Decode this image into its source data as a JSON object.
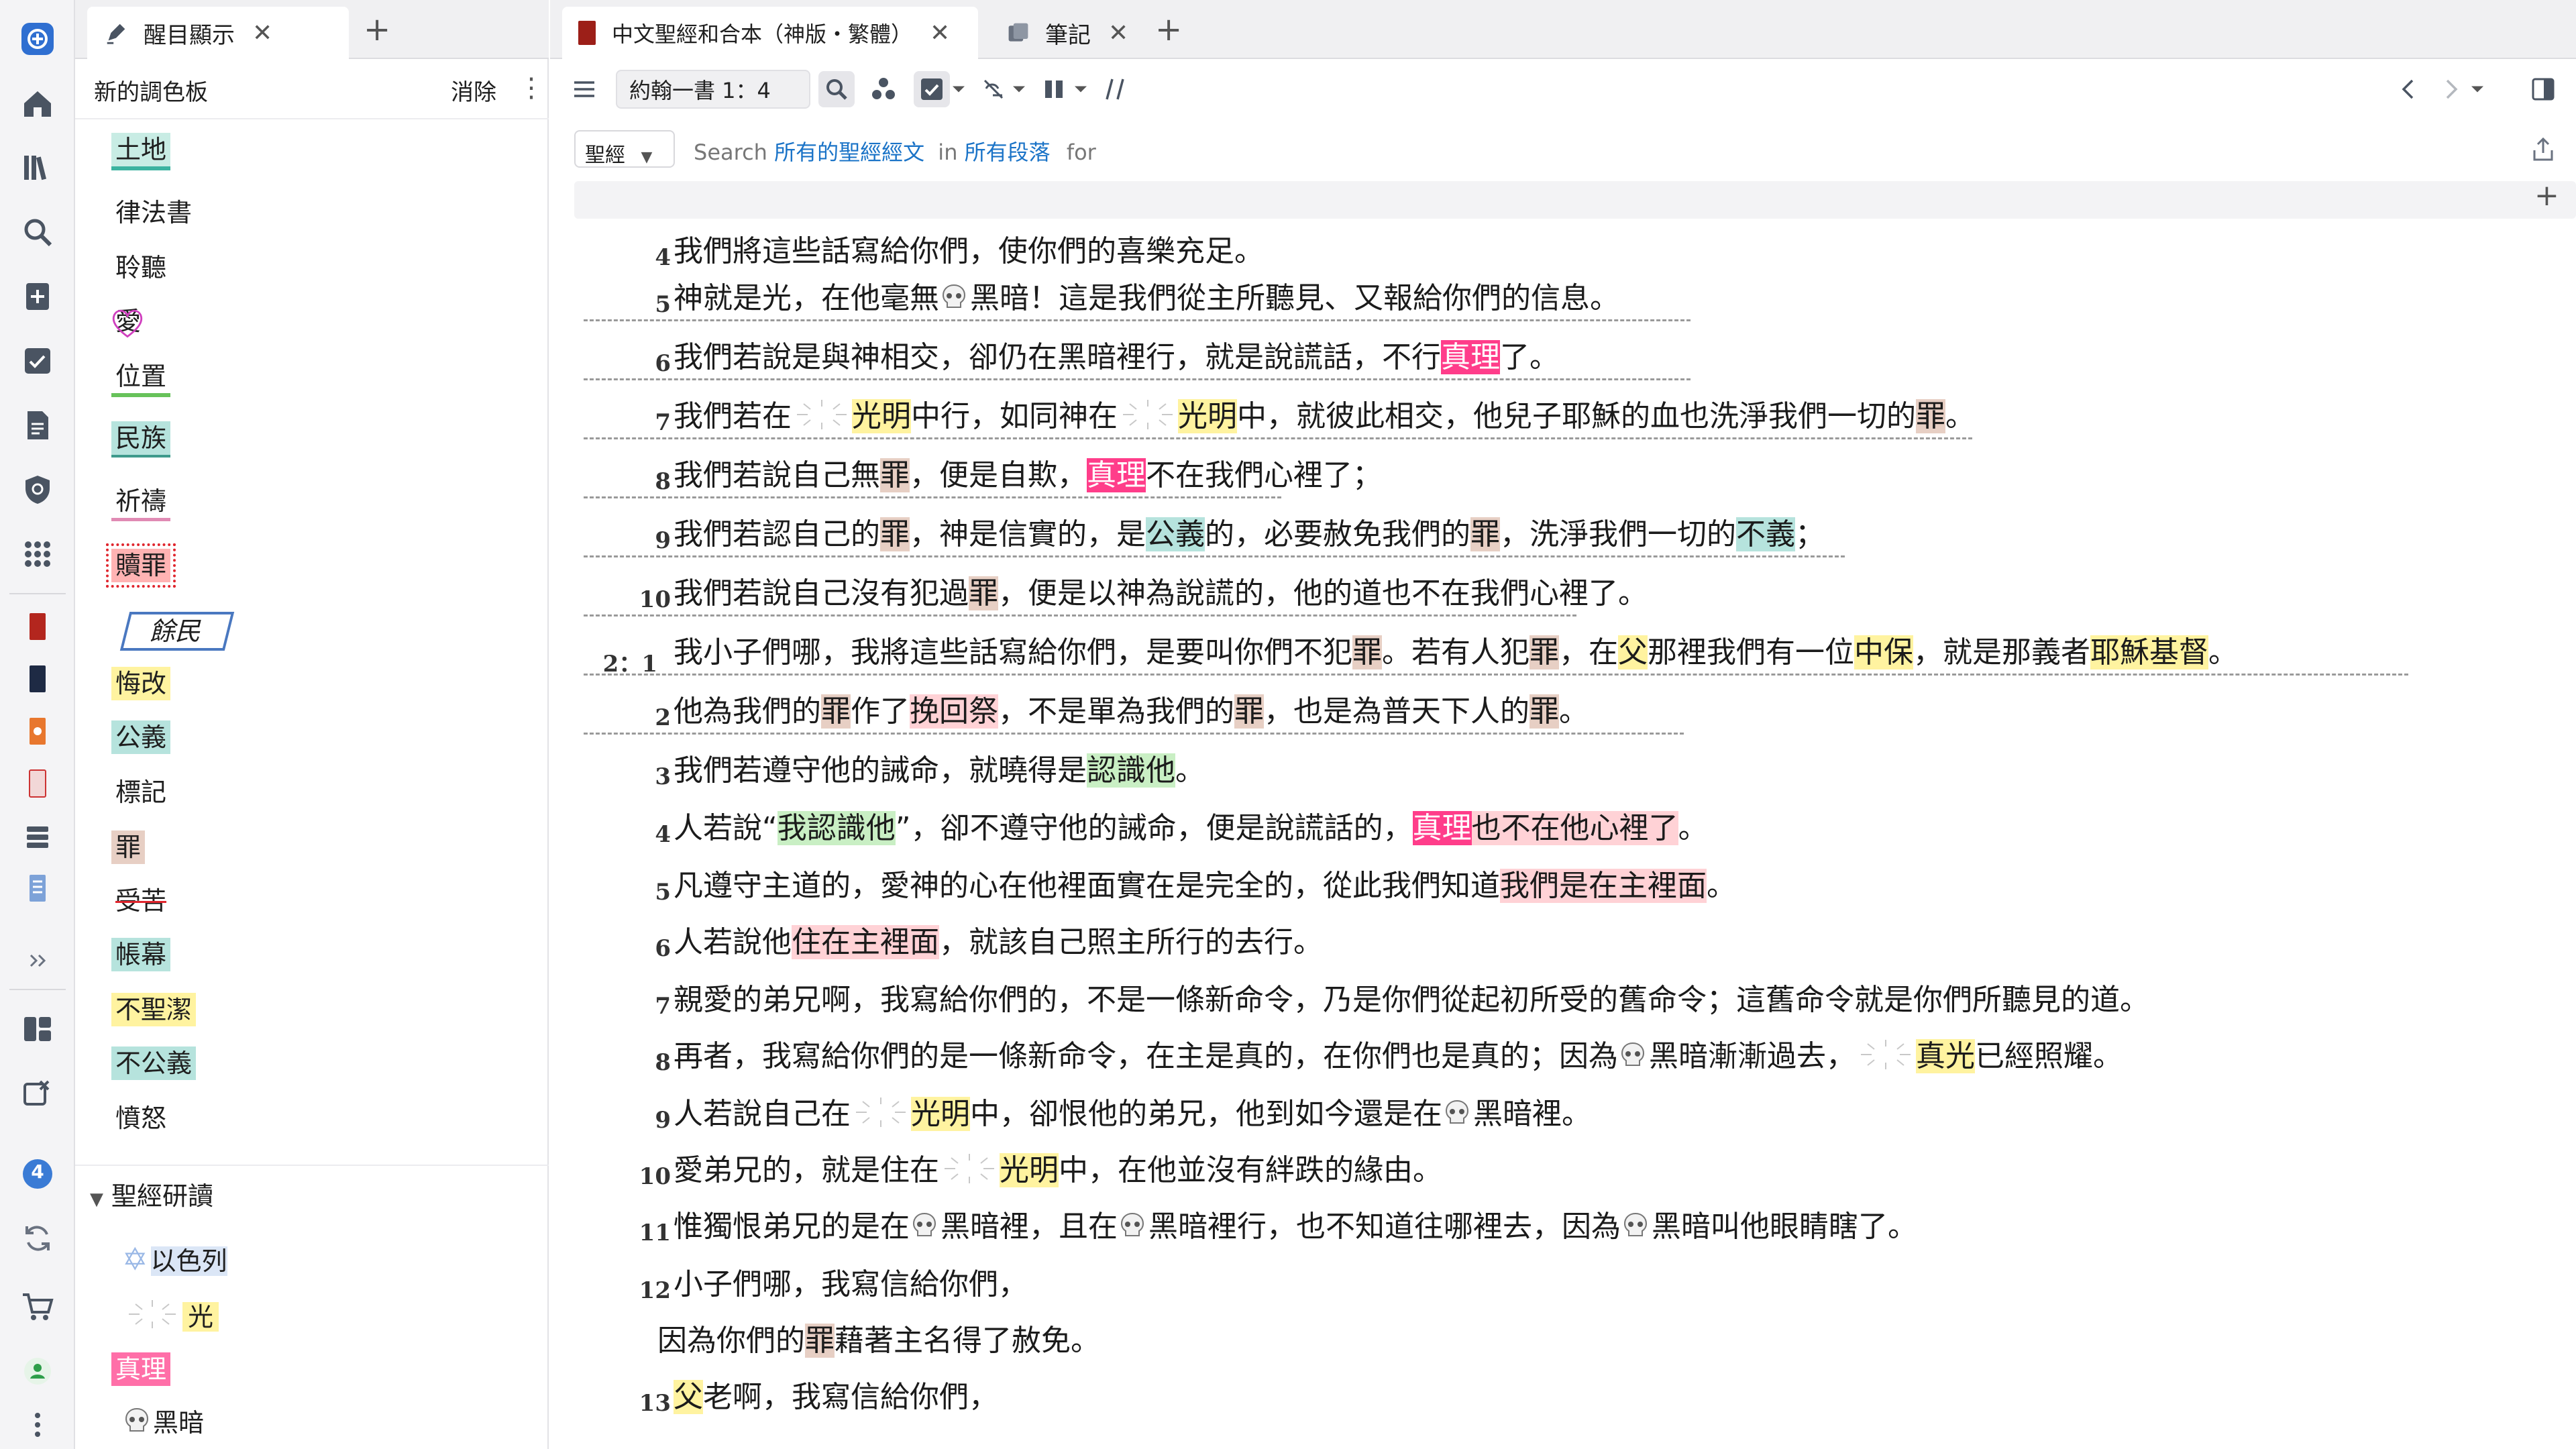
{
  "rail": {
    "icons": [
      "app-logo-icon",
      "home-icon",
      "library-icon",
      "search-icon",
      "add-note-icon",
      "checklist-icon",
      "document-icon",
      "shield-icon",
      "apps-grid-icon",
      "book-red-icon",
      "book-dark-icon",
      "book-orange-icon",
      "book-white-icon",
      "stack-icon",
      "book-blue-icon",
      "expand-icon",
      "layout-icon",
      "export-icon",
      "notification-badge",
      "sync-icon",
      "cart-icon",
      "user-icon",
      "more-icon"
    ],
    "badge": "4"
  },
  "left": {
    "tab_label": "醒目顯示",
    "palette_title": "新的調色板",
    "clear_label": "消除",
    "palette_items": [
      {
        "label": "土地",
        "style": "teal-underline"
      },
      {
        "label": "律法書",
        "style": "plain"
      },
      {
        "label": "聆聽",
        "style": "plain"
      },
      {
        "label": "愛",
        "style": "heart"
      },
      {
        "label": "位置",
        "style": "green-underline"
      },
      {
        "label": "民族",
        "style": "teal-box"
      },
      {
        "label": "祈禱",
        "style": "pink-underline"
      },
      {
        "label": "贖罪",
        "style": "red-burst"
      },
      {
        "label": "餘民",
        "style": "box-outline"
      },
      {
        "label": "悔改",
        "style": "yellow"
      },
      {
        "label": "公義",
        "style": "teal"
      },
      {
        "label": "標記",
        "style": "plain"
      },
      {
        "label": "罪",
        "style": "brown"
      },
      {
        "label": "受苦",
        "style": "strike"
      },
      {
        "label": "帳幕",
        "style": "teal"
      },
      {
        "label": "不聖潔",
        "style": "yellow"
      },
      {
        "label": "不公義",
        "style": "teal"
      },
      {
        "label": "憤怒",
        "style": "plain"
      }
    ],
    "study_title": "聖經研讀",
    "study_items": [
      {
        "label": "以色列",
        "style": "star"
      },
      {
        "label": "光",
        "style": "light"
      },
      {
        "label": "真理",
        "style": "pink"
      },
      {
        "label": "黑暗",
        "style": "skull"
      }
    ]
  },
  "main": {
    "tab_bible": "中文聖經和合本（神版・繁體）",
    "tab_notes": "筆記",
    "reference": "約翰一書 1：4",
    "scope": "聖經",
    "search": {
      "prefix": "Search",
      "all": "所有的聖經經文",
      "in": "in",
      "section": "所有段落",
      "for": "for"
    },
    "verses": [
      {
        "num": "4",
        "text": "我們將這些話寫給你們，使你們的喜樂充足。"
      },
      {
        "num": "5",
        "text": "神就是光，在他毫無[黑暗]！這是我們從主所聽見、又報給你們的信息。"
      },
      {
        "num": "6",
        "text": "我們若說是與神相交，卻仍在黑暗裡行，就是說謊話，不行真理了。"
      },
      {
        "num": "7",
        "text": "我們若在[光明]中行，如同神在[光明]中，就彼此相交，他兒子耶穌的血也洗淨我們一切的罪。"
      },
      {
        "num": "8",
        "text": "我們若說自己無罪，便是自欺，真理不在我們心裡了；"
      },
      {
        "num": "9",
        "text": "我們若認自己的罪，神是信實的，是公義的，必要赦免我們的罪，洗淨我們一切的不義；"
      },
      {
        "num": "10",
        "text": "我們若說自己沒有犯過罪，便是以神為說謊的，他的道也不在我們心裡了。"
      },
      {
        "num": "2：1",
        "text": "我小子們哪，我將這些話寫給你們，是要叫你們不犯罪。若有人犯罪，在父那裡我們有一位中保，就是那義者耶穌基督。"
      },
      {
        "num": "2",
        "text": "他為我們的罪作了挽回祭，不是單為我們的罪，也是為普天下人的罪。"
      },
      {
        "num": "3",
        "text": "我們若遵守他的誡命，就曉得是認識他。"
      },
      {
        "num": "4",
        "text": "人若說“我認識他”，卻不遵守他的誡命，便是說謊話的，真理也不在他心裡了。"
      },
      {
        "num": "5",
        "text": "凡遵守主道的，愛神的心在他裡面實在是完全的，從此我們知道我們是在主裡面。"
      },
      {
        "num": "6",
        "text": "人若說他住在主裡面，就該自己照主所行的去行。"
      },
      {
        "num": "7",
        "text": "親愛的弟兄啊，我寫給你們的，不是一條新命令，乃是你們從起初所受的舊命令；這舊命令就是你們所聽見的道。"
      },
      {
        "num": "8",
        "text": "再者，我寫給你們的是一條新命令，在主是真的，在你們也是真的；因為[黑暗]漸漸過去，[真光]已經照耀。"
      },
      {
        "num": "9",
        "text": "人若說自己在[光明]中，卻恨他的弟兄，他到如今還是在[黑暗]裡。"
      },
      {
        "num": "10",
        "text": "愛弟兄的，就是住在[光明]中，在他並沒有絆跌的緣由。"
      },
      {
        "num": "11",
        "text": "惟獨恨弟兄的是在[黑暗]裡，且在[黑暗]裡行，也不知道往哪裡去，因為[黑暗]叫他眼睛瞎了。"
      },
      {
        "num": "12",
        "text": "小子們哪，我寫信給你們，"
      },
      {
        "num": "",
        "text": "因為你們的罪藉著主名得了赦免。"
      },
      {
        "num": "13",
        "text": "父老啊，我寫信給你們，"
      }
    ]
  },
  "colors": {
    "yellow": "#fff3a0",
    "green": "#c9efc4",
    "teal": "#b6e3dd",
    "pink": "#ffd2d6",
    "hot_pink": "#ff3d8a",
    "brown": "#e7cfc4",
    "accent": "#1a73c7"
  }
}
